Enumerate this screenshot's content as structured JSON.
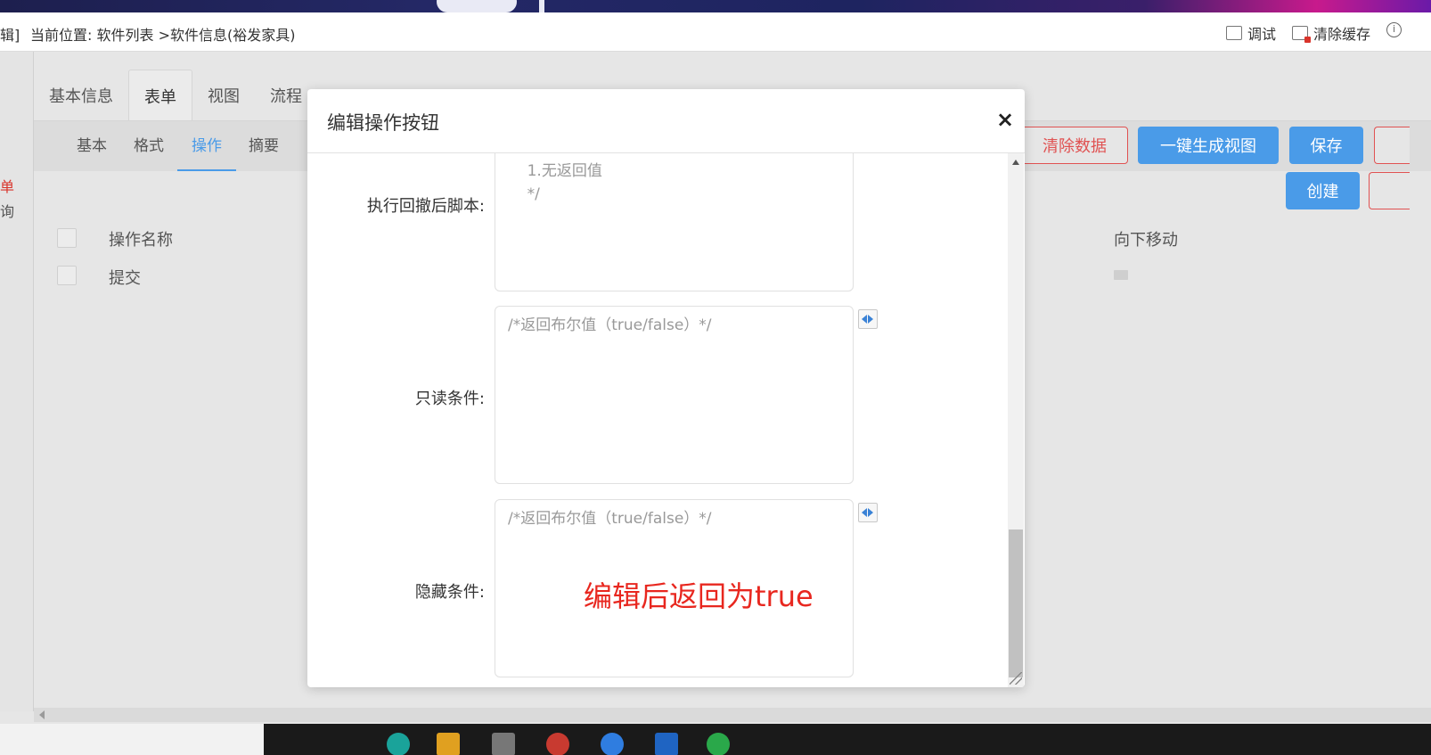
{
  "header": {
    "edit_fragment": "辑]",
    "breadcrumb": "当前位置: 软件列表 >软件信息(裕发家具)",
    "debug_label": "调试",
    "clear_cache_label": "清除缓存",
    "info_glyph": "i"
  },
  "sidebar": {
    "link_fragment": "单",
    "text_fragment": "询"
  },
  "tabs": {
    "items": [
      "基本信息",
      "表单",
      "视图",
      "流程"
    ]
  },
  "subtabs": {
    "items": [
      "基本",
      "格式",
      "操作",
      "摘要"
    ]
  },
  "actions": {
    "clear_data": "清除数据",
    "generate_view": "一键生成视图",
    "save": "保存",
    "create": "创建"
  },
  "table": {
    "header_name": "操作名称",
    "header_move_down": "向下移动",
    "rows": [
      {
        "name": "提交"
      }
    ]
  },
  "modal": {
    "title": "编辑操作按钮",
    "close_glyph": "×",
    "fields": [
      {
        "label": "执行回撤后脚本:",
        "content": "    1.无返回值\n    */"
      },
      {
        "label": "只读条件:",
        "content": "/*返回布尔值（true/false）*/"
      },
      {
        "label": "隐藏条件:",
        "content": "/*返回布尔值（true/false）*/"
      }
    ],
    "annotation": "编辑后返回为true"
  },
  "colors": {
    "accent_blue": "#4a9be8",
    "danger_red": "#e05252",
    "annotation_red": "#e8271f"
  }
}
